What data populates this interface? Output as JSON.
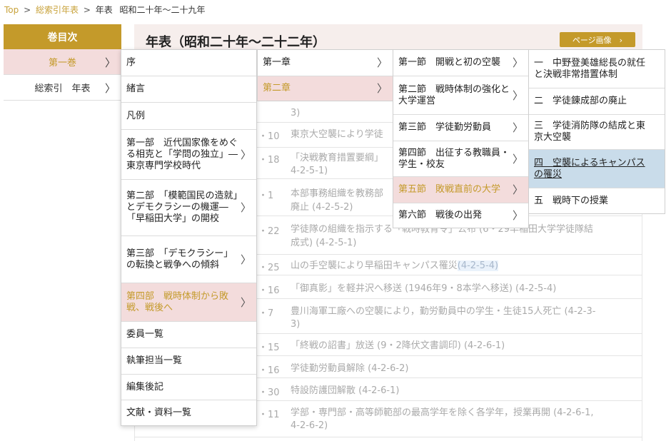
{
  "breadcrumb": {
    "top": "Top",
    "sep1": ">",
    "index": "総索引年表",
    "sep2": ">",
    "nenpyo": "年表",
    "current": "昭和二十年〜二十九年"
  },
  "toc": {
    "heading": "巻目次",
    "items": [
      {
        "label": "第一巻",
        "chevron": "〉"
      },
      {
        "label": "総索引　年表",
        "chevron": "〉"
      }
    ]
  },
  "main": {
    "title": "年表（昭和二十年〜二十二年）",
    "page_image_button": "ページ画像　›",
    "rows": [
      {
        "date": "",
        "text": "3)"
      },
      {
        "date": "・10",
        "text": "東京大空襲により学徒"
      },
      {
        "date": "・18",
        "text": "「決戦教育措置要綱」"
      },
      {
        "date": "",
        "text": "4-2-5-1)"
      },
      {
        "date": "・1",
        "text": "本部事務組織を教務部"
      },
      {
        "date": "",
        "text": "廃止 (4-2-5-2)"
      },
      {
        "date": "・22",
        "text": "学徒隊の組織を指示する「戦時教育令」公布 (6・29早稲田大学学徒隊結"
      },
      {
        "date": "",
        "text": "成式) (4-2-5-1)"
      },
      {
        "date": "・25",
        "text": "山の手空襲により早稲田キャンパス罹災",
        "link": "(4-2-5-4)"
      },
      {
        "date": "・16",
        "text": "「御真影」を軽井沢へ移送 (1946年9・8本学へ移送) (4-2-5-4)"
      },
      {
        "date": "・7",
        "text": "豊川海軍工廠への空襲により，勤労動員中の学生・生徒15人死亡 (4-2-3-"
      },
      {
        "date": "",
        "text": "3)"
      },
      {
        "date": "・15",
        "text": "「終戦の詔書」放送 (9・2降伏文書調印) (4-2-6-1)"
      },
      {
        "date": "・16",
        "text": "学徒勤労動員解除 (4-2-6-2)"
      },
      {
        "date": "・30",
        "text": "特設防護団解散 (4-2-6-1)"
      },
      {
        "date": "・11",
        "text": "学部・専門部・高等師範部の最高学年を除く各学年，授業再開 (4-2-6-1,"
      },
      {
        "date": "",
        "text": "4-2-6-2)"
      }
    ]
  },
  "menu_parts": [
    {
      "label": "序",
      "chevron": ""
    },
    {
      "label": "緒言",
      "chevron": ""
    },
    {
      "label": "凡例",
      "chevron": ""
    },
    {
      "label": "第一部　近代国家像をめぐる相克と「学問の独立」―東京専門学校時代",
      "chevron": "〉"
    },
    {
      "label": "第二部　「模範国民の造就」とデモクラシーの機運―「早稲田大学」の開校",
      "chevron": "〉"
    },
    {
      "label": "第三部　「デモクラシー」の転換と戦争への傾斜",
      "chevron": "〉"
    },
    {
      "label": "第四部　戦時体制から敗戦、戦後へ",
      "chevron": "〉"
    },
    {
      "label": "委員一覧",
      "chevron": ""
    },
    {
      "label": "執筆担当一覧",
      "chevron": ""
    },
    {
      "label": "編集後記",
      "chevron": ""
    },
    {
      "label": "文献・資料一覧",
      "chevron": ""
    }
  ],
  "menu_chapters": [
    {
      "label": "第一章",
      "chevron": "〉"
    },
    {
      "label": "第二章",
      "chevron": "〉"
    }
  ],
  "menu_sections": [
    {
      "label": "第一節　開戦と初の空襲",
      "chevron": "〉"
    },
    {
      "label": "第二節　戦時体制の強化と大学運営",
      "chevron": "〉"
    },
    {
      "label": "第三節　学徒勤労動員",
      "chevron": "〉"
    },
    {
      "label": "第四節　出征する教職員・学生・校友",
      "chevron": "〉"
    },
    {
      "label": "第五節　敗戦直前の大学",
      "chevron": "〉"
    },
    {
      "label": "第六節　戦後の出発",
      "chevron": "〉"
    }
  ],
  "menu_subsections": [
    {
      "label": "一　中野登美雄総長の就任と決戦非常措置体制"
    },
    {
      "label": "二　学徒錬成部の廃止"
    },
    {
      "label": "三　学徒消防隊の結成と東京大空襲"
    },
    {
      "label": "四　空襲によるキャンパスの罹災"
    },
    {
      "label": "五　戦時下の授業"
    }
  ],
  "colors": {
    "accent": "#c49a2a",
    "active_bg": "#f3dcdc",
    "current_bg": "#c9dcea"
  }
}
